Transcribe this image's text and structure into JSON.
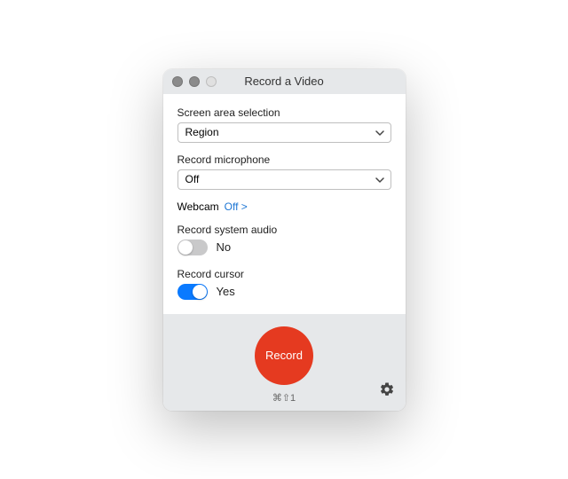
{
  "window": {
    "title": "Record a Video"
  },
  "fields": {
    "screen_area": {
      "label": "Screen area selection",
      "value": "Region"
    },
    "microphone": {
      "label": "Record microphone",
      "value": "Off"
    },
    "webcam": {
      "label": "Webcam",
      "link": "Off >"
    },
    "system_audio": {
      "label": "Record system audio",
      "on": false,
      "text": "No"
    },
    "cursor": {
      "label": "Record cursor",
      "on": true,
      "text": "Yes"
    }
  },
  "footer": {
    "record_label": "Record",
    "shortcut": "⌘⇧1"
  }
}
